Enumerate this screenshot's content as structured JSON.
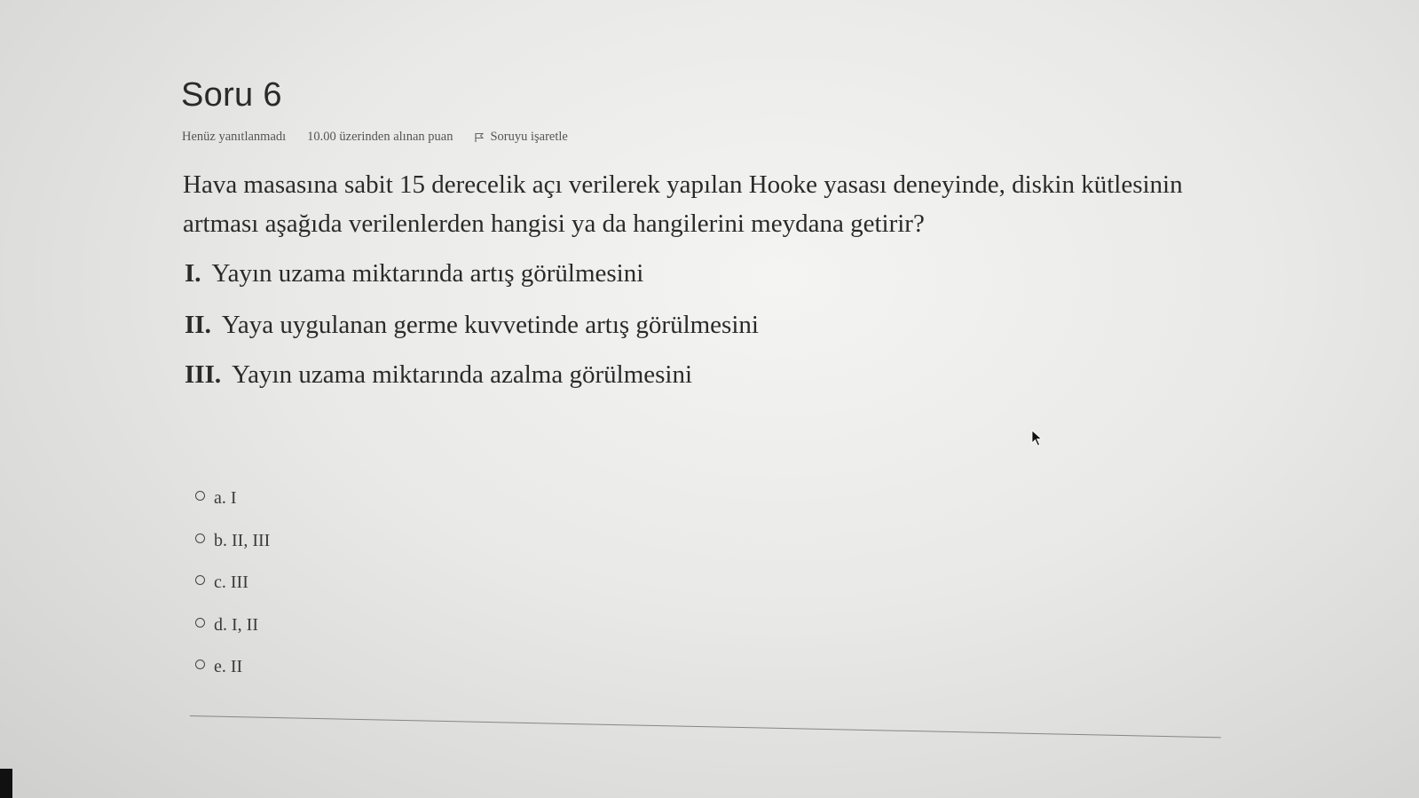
{
  "question": {
    "title": "Soru 6",
    "state": "Henüz yanıtlanmadı",
    "grade": "10.00 üzerinden alınan puan",
    "flag_label": "Soruyu işaretle",
    "text": "Hava masasına sabit 15 derecelik açı verilerek yapılan Hooke yasası deneyinde, diskin kütlesinin artması aşağıda verilenlerden hangisi ya da hangilerini meydana getirir?",
    "statements": [
      {
        "num": "I.",
        "text": "Yayın uzama miktarında artış görülmesini"
      },
      {
        "num": "II.",
        "text": "Yaya uygulanan germe kuvvetinde artış görülmesini"
      },
      {
        "num": "III.",
        "text": "Yayın uzama miktarında azalma görülmesini"
      }
    ],
    "options": [
      {
        "label": "a. I",
        "selected": false
      },
      {
        "label": "b. II, III",
        "selected": false
      },
      {
        "label": "c. III",
        "selected": false
      },
      {
        "label": "d. I, II",
        "selected": false
      },
      {
        "label": "e. II",
        "selected": false
      }
    ]
  },
  "icons": {
    "flag": "flag-icon",
    "cursor": "mouse-cursor-icon",
    "radio": "radio-button"
  }
}
